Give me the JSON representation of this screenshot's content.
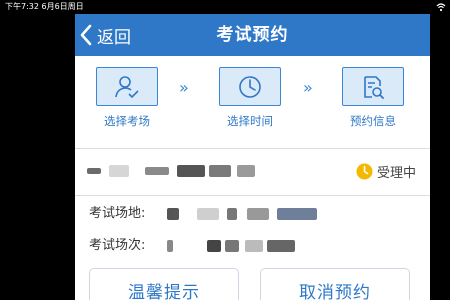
{
  "status_bar": {
    "time": "下午7:32  6月6日周日",
    "wifi_icon": "wifi-icon"
  },
  "navbar": {
    "back_label": "返回",
    "title": "考试预约",
    "color": "#2f78c8"
  },
  "steps": [
    {
      "label": "选择考场",
      "icon": "person-check-icon"
    },
    {
      "label": "选择时间",
      "icon": "clock-icon"
    },
    {
      "label": "预约信息",
      "icon": "document-search-icon"
    }
  ],
  "status": {
    "label": "受理中",
    "icon": "clock-badge-icon",
    "icon_color": "#f5b800"
  },
  "info": {
    "venue_label": "考试场地:",
    "session_label": "考试场次:"
  },
  "buttons": {
    "tips": "温馨提示",
    "cancel": "取消预约"
  }
}
